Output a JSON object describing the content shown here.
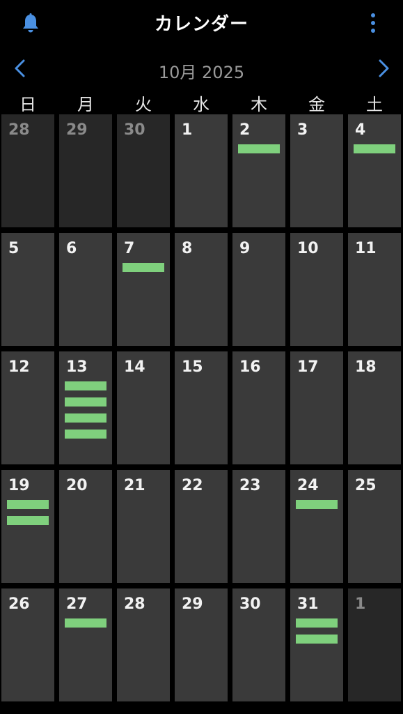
{
  "app": {
    "title": "カレンダー",
    "month_label": "10月 2025",
    "accent_color": "#4a90e2",
    "event_color": "#7fd07d",
    "icons": {
      "bell": "bell-icon",
      "more": "more-vertical-icon",
      "prev": "chevron-left-icon",
      "next": "chevron-right-icon"
    }
  },
  "weekdays": [
    "日",
    "月",
    "火",
    "水",
    "木",
    "金",
    "土"
  ],
  "weeks": [
    [
      {
        "day": "28",
        "other": true,
        "events": 0
      },
      {
        "day": "29",
        "other": true,
        "events": 0
      },
      {
        "day": "30",
        "other": true,
        "events": 0
      },
      {
        "day": "1",
        "other": false,
        "events": 0
      },
      {
        "day": "2",
        "other": false,
        "events": 1
      },
      {
        "day": "3",
        "other": false,
        "events": 0
      },
      {
        "day": "4",
        "other": false,
        "events": 1
      }
    ],
    [
      {
        "day": "5",
        "other": false,
        "events": 0
      },
      {
        "day": "6",
        "other": false,
        "events": 0
      },
      {
        "day": "7",
        "other": false,
        "events": 1
      },
      {
        "day": "8",
        "other": false,
        "events": 0
      },
      {
        "day": "9",
        "other": false,
        "events": 0
      },
      {
        "day": "10",
        "other": false,
        "events": 0
      },
      {
        "day": "11",
        "other": false,
        "events": 0
      }
    ],
    [
      {
        "day": "12",
        "other": false,
        "events": 0
      },
      {
        "day": "13",
        "other": false,
        "events": 4
      },
      {
        "day": "14",
        "other": false,
        "events": 0
      },
      {
        "day": "15",
        "other": false,
        "events": 0
      },
      {
        "day": "16",
        "other": false,
        "events": 0
      },
      {
        "day": "17",
        "other": false,
        "events": 0
      },
      {
        "day": "18",
        "other": false,
        "events": 0
      }
    ],
    [
      {
        "day": "19",
        "other": false,
        "events": 2
      },
      {
        "day": "20",
        "other": false,
        "events": 0
      },
      {
        "day": "21",
        "other": false,
        "events": 0
      },
      {
        "day": "22",
        "other": false,
        "events": 0
      },
      {
        "day": "23",
        "other": false,
        "events": 0
      },
      {
        "day": "24",
        "other": false,
        "events": 1
      },
      {
        "day": "25",
        "other": false,
        "events": 0
      }
    ],
    [
      {
        "day": "26",
        "other": false,
        "events": 0
      },
      {
        "day": "27",
        "other": false,
        "events": 1
      },
      {
        "day": "28",
        "other": false,
        "events": 0
      },
      {
        "day": "29",
        "other": false,
        "events": 0
      },
      {
        "day": "30",
        "other": false,
        "events": 0
      },
      {
        "day": "31",
        "other": false,
        "events": 2
      },
      {
        "day": "1",
        "other": true,
        "events": 0
      }
    ]
  ]
}
